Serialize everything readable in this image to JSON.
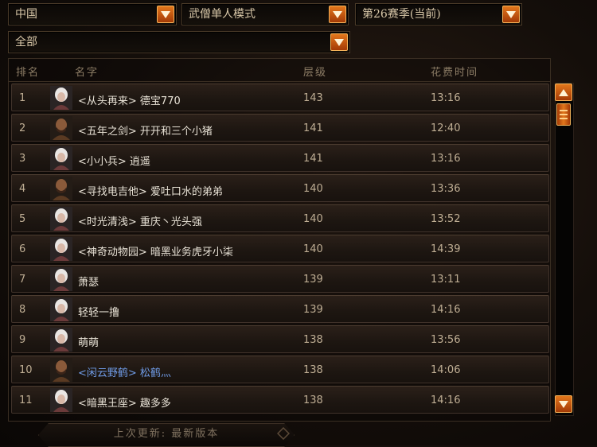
{
  "filters": {
    "region": "中国",
    "mode": "武僧单人模式",
    "season": "第26赛季(当前)",
    "category": "全部"
  },
  "columns": {
    "rank": "排名",
    "name": "名字",
    "level": "层级",
    "time": "花费时间"
  },
  "rows": [
    {
      "rank": "1",
      "name": "<从头再来> 德宝770",
      "level": "143",
      "time": "13:16",
      "avatar": "monk-female"
    },
    {
      "rank": "2",
      "name": "<五年之剑> 开开和三个小猪",
      "level": "141",
      "time": "12:40",
      "avatar": "monk-male"
    },
    {
      "rank": "3",
      "name": "<小小兵> 逍遥",
      "level": "141",
      "time": "13:16",
      "avatar": "monk-female"
    },
    {
      "rank": "4",
      "name": "<寻找电吉他> 爱吐口水的弟弟",
      "level": "140",
      "time": "13:36",
      "avatar": "monk-male"
    },
    {
      "rank": "5",
      "name": "<时光清浅> 重庆丶光头强",
      "level": "140",
      "time": "13:52",
      "avatar": "monk-female"
    },
    {
      "rank": "6",
      "name": "<神奇动物园> 暗黑业务虎牙小柒",
      "level": "140",
      "time": "14:39",
      "avatar": "monk-female"
    },
    {
      "rank": "7",
      "name": "萧瑟",
      "level": "139",
      "time": "13:11",
      "avatar": "monk-female"
    },
    {
      "rank": "8",
      "name": "轻轻一撸",
      "level": "139",
      "time": "14:16",
      "avatar": "monk-female"
    },
    {
      "rank": "9",
      "name": "萌萌",
      "level": "138",
      "time": "13:56",
      "avatar": "monk-female"
    },
    {
      "rank": "10",
      "name": "<闲云野鹤> 松鹤灬",
      "level": "138",
      "time": "14:06",
      "avatar": "monk-male"
    },
    {
      "rank": "11",
      "name": "<暗黑王座> 趣多多",
      "level": "138",
      "time": "14:16",
      "avatar": "monk-female"
    }
  ],
  "footer": {
    "last_update": "上次更新: 最新版本"
  },
  "colors": {
    "accent": "#e2771c",
    "clan_highlight": "#6f9be6",
    "text": "#bfae94"
  }
}
